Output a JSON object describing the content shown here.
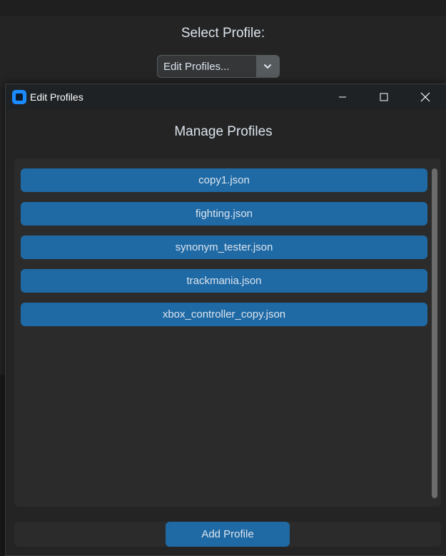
{
  "background": {
    "title": "Select Profile:",
    "combobox": {
      "value": "Edit Profiles..."
    }
  },
  "dialog": {
    "window_title": "Edit Profiles",
    "heading": "Manage Profiles",
    "profiles": [
      {
        "label": "copy1.json"
      },
      {
        "label": "fighting.json"
      },
      {
        "label": "synonym_tester.json"
      },
      {
        "label": "trackmania.json"
      },
      {
        "label": "xbox_controller_copy.json"
      }
    ],
    "add_button_label": "Add Profile"
  },
  "colors": {
    "accent": "#1f6aa5",
    "window_bg": "#242424",
    "frame_bg": "#2b2b2b",
    "text": "#dce4ee",
    "app_icon": "#1a8cff"
  },
  "icons": {
    "app": "app-icon",
    "minimize": "minimize-icon",
    "maximize": "maximize-icon",
    "close": "close-icon",
    "dropdown": "chevron-down-icon"
  }
}
